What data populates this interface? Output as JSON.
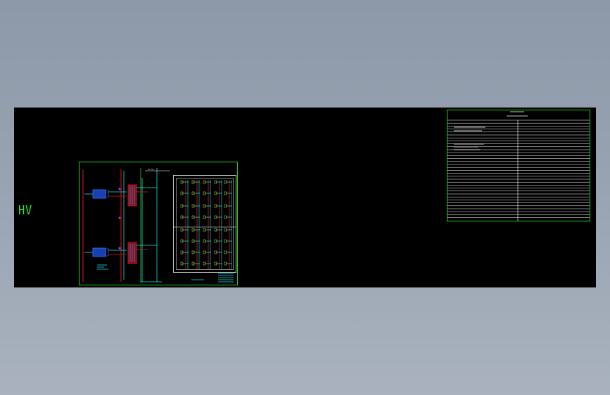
{
  "viewport": {
    "label": "HV"
  },
  "schedule_table": {
    "row_count": 34
  },
  "colors": {
    "background": "#000000",
    "frame": "#19d219",
    "pipe_red": "#e01818",
    "pipe_cyan": "#17e0e0",
    "equipment_blue": "#2a7bff",
    "accent_magenta": "#e01fe0",
    "text_yellow": "#e8e81e",
    "text_white": "#ffffff"
  }
}
